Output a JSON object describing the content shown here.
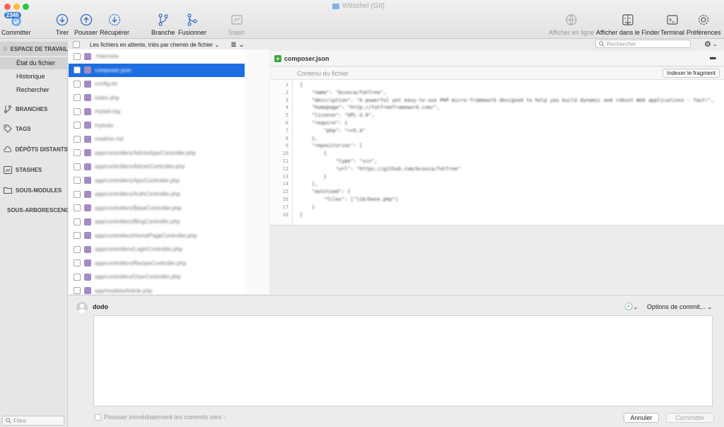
{
  "window": {
    "title": "Witschel (Git)"
  },
  "colors": {
    "accent": "#1d6ee0",
    "badge": "#3a7bd5",
    "addedGreen": "#3ca640",
    "fileIcon": "#a48bc4"
  },
  "toolbar": {
    "badge": "2346",
    "commit": "Committer",
    "pull": "Tirer",
    "push": "Pousser",
    "fetch": "Récupérer",
    "branch": "Branche",
    "merge": "Fusionner",
    "stash": "Stash",
    "remote": "Afficher en ligne",
    "finder": "Afficher dans le Finder",
    "terminal": "Terminal",
    "prefs": "Préférences"
  },
  "sidebar": {
    "workspace": "ESPACE DE TRAVAIL",
    "items": [
      "État du fichier",
      "Historique",
      "Rechercher"
    ],
    "branches": "BRANCHES",
    "tags": "TAGS",
    "remotes": "DÉPÔTS DISTANTS",
    "stashes": "STASHES",
    "submodules": "SOUS-MODULES",
    "subtrees": "SOUS-ARBORESCENCES",
    "filter": "Filtre"
  },
  "filelist": {
    "header": "Les fichiers en attente, triés par chemin de fichier",
    "files": [
      ".htaccess",
      "composer.json",
      "config.ini",
      "index.php",
      "mylast.log",
      "mytodo",
      "readme.md",
      "app/controllers/AdminAjaxController.php",
      "app/controllers/AdminController.php",
      "app/controllers/AjaxController.php",
      "app/controllers/AuthController.php",
      "app/controllers/BaseController.php",
      "app/controllers/BlogController.php",
      "app/controllers/HomePageController.php",
      "app/controllers/LoginController.php",
      "app/controllers/RecipeController.php",
      "app/controllers/UserController.php",
      "app/models/Article.php"
    ],
    "selected_index": 1,
    "more": "•••"
  },
  "search": {
    "placeholder": "Rechercher"
  },
  "diff": {
    "filename": "composer.json",
    "hunk_title": "Contenu du fichier",
    "stage_hunk": "Indexer le fragment",
    "lines": [
      "{",
      "    \"name\": \"bcosca/fatfree\",",
      "    \"description\": \"A powerful yet easy-to-use PHP micro-framework designed to help you build dynamic and robust Web applications - fast!\",",
      "    \"homepage\": \"http://fatfreeframework.com/\",",
      "    \"license\": \"GPL-3.0\",",
      "    \"require\": {",
      "        \"php\": \">=5.4\"",
      "    },",
      "    \"repositories\": [",
      "        {",
      "            \"type\": \"vcs\",",
      "            \"url\": \"https://github.com/bcosca/fatfree\"",
      "        }",
      "    ],",
      "    \"autoload\": {",
      "        \"files\": [\"lib/base.php\"]",
      "    }",
      "}"
    ]
  },
  "commit": {
    "user": "dodo",
    "options": "Options de commit...",
    "push_label": "Pousser immédiatement les commits vers -",
    "cancel": "Annuler",
    "commit": "Committer"
  }
}
